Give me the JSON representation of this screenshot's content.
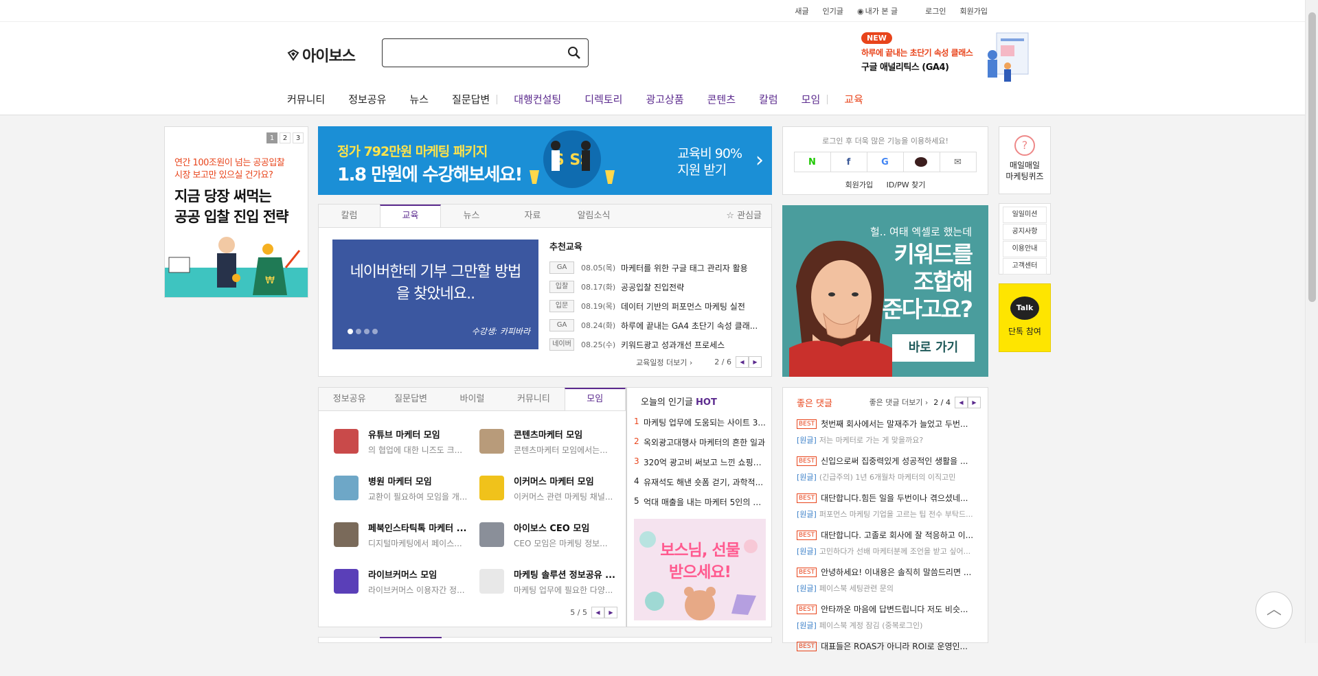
{
  "topbar": {
    "new_posts": "새글",
    "popular": "인기글",
    "my_viewed": "내가 본 글",
    "login": "로그인",
    "signup": "회원가입"
  },
  "logo": "아이보스",
  "search": {
    "placeholder": ""
  },
  "promo": {
    "badge": "NEW",
    "line1": "하루에 끝내는 초단기 속성 클래스",
    "line2": "구글 애널리틱스 (GA4)"
  },
  "nav": {
    "community": "커뮤니티",
    "info": "정보공유",
    "news": "뉴스",
    "qa": "질문답변",
    "agency": "대행컨설팅",
    "directory": "디렉토리",
    "ads": "광고상품",
    "contents": "콘텐츠",
    "column": "칼럼",
    "meeting": "모임",
    "education": "교육"
  },
  "left_ad": {
    "pages": [
      "1",
      "2",
      "3"
    ],
    "line1": "연간 100조원이 넘는 공공입찰",
    "line2": "시장 보고만 있으실 건가요?",
    "line3": "지금 당장 써먹는",
    "line4": "공공 입찰 진입 전략"
  },
  "banner": {
    "line1": "정가 792만원 마케팅 패키지",
    "line2": "1.8 만원에 수강해보세요!",
    "line3": "교육비 90%",
    "line4": "지원 받기"
  },
  "edu": {
    "tabs": [
      "칼럼",
      "교육",
      "뉴스",
      "자료",
      "알림소식"
    ],
    "fav": "☆ 관심글",
    "slide_text": "네이버한테 기부 그만할 방법을 찾았네요..",
    "slide_credit": "수강생: 카피바라",
    "rec_title": "추천교육",
    "items": [
      {
        "badge": "GA",
        "date": "08.05(목)",
        "title": "마케터를 위한 구글 태그 관리자 활용"
      },
      {
        "badge": "입찰",
        "date": "08.17(화)",
        "title": "공공입찰 진입전략"
      },
      {
        "badge": "입문",
        "date": "08.19(목)",
        "title": "데이터 기반의 퍼포먼스 마케팅 실전"
      },
      {
        "badge": "GA",
        "date": "08.24(화)",
        "title": "하루에 끝내는 GA4 초단기 속성 클래..."
      },
      {
        "badge": "네이버",
        "date": "08.25(수)",
        "title": "키워드광고 성과개선 프로세스"
      }
    ],
    "more": "교육일정 더보기 ›",
    "page": "2 / 6"
  },
  "login_box": {
    "message": "로그인 후 더욱 많은 기능을 이용하세요!",
    "signup": "회원가입",
    "find": "ID/PW 찾기"
  },
  "right_ad": {
    "line1": "헐.. 여태 엑셀로 했는데",
    "line2": "키워드를",
    "line3": "조합해",
    "line4": "준다고요?",
    "button": "바로 가기"
  },
  "side": {
    "quiz_line1": "매일매일",
    "quiz_line2": "마케팅퀴즈",
    "menu": [
      "일일미션",
      "공지사항",
      "이용안내",
      "고객센터"
    ],
    "talk_bubble": "Talk",
    "talk_label": "단톡 참여"
  },
  "meet": {
    "tabs": [
      "정보공유",
      "질문답변",
      "바이럴",
      "커뮤니티",
      "모임"
    ],
    "items": [
      {
        "name": "유튜브 마케터 모임",
        "desc": "의 협업에 대한 니즈도 크...",
        "color": "#c94a4a"
      },
      {
        "name": "콘텐츠마케터 모임",
        "desc": "콘텐츠마케터 모임에서는...",
        "color": "#b89b7a"
      },
      {
        "name": "병원 마케터 모임",
        "desc": "교환이 필요하여 모임을 개...",
        "color": "#6ea7c7"
      },
      {
        "name": "이커머스 마케터 모임",
        "desc": "이커머스 관련 마케팅 채널...",
        "color": "#f0c21b"
      },
      {
        "name": "페북인스타틱톡 마케터 ...",
        "desc": "디지털마케팅에서 페이스...",
        "color": "#7a6a5a"
      },
      {
        "name": "아이보스 CEO 모임",
        "desc": "CEO 모임은 마케팅 정보...",
        "color": "#8a8f99"
      },
      {
        "name": "라이브커머스 모임",
        "desc": "라이브커머스 이용자간 정...",
        "color": "#5a3fb8"
      },
      {
        "name": "마케팅 솔루션 정보공유 ...",
        "desc": "마케팅 업무에 필요한 다양...",
        "color": "#e8e8e8"
      }
    ],
    "page": "5 / 5"
  },
  "popular": {
    "title": "오늘의 인기글",
    "hot": "HOT",
    "items": [
      {
        "n": "1",
        "t": "마케팅 업무에 도움되는 사이트 3..."
      },
      {
        "n": "2",
        "t": "옥외광고대행사 마케터의 흔한 일과"
      },
      {
        "n": "3",
        "t": "320억 광고비 써보고 느낀 쇼핑몰..."
      },
      {
        "n": "4",
        "t": "유재석도 해낸 숏폼 걷기, 과학적..."
      },
      {
        "n": "5",
        "t": "억대 매출을 내는 마케터 5인의 이..."
      }
    ],
    "gift_line1": "보스님, 선물",
    "gift_line2": "받으세요!"
  },
  "comments": {
    "title": "좋은 댓글",
    "more": "좋은 댓글 더보기 ›",
    "page": "2 / 4",
    "best": "BEST",
    "origin": "[원글]",
    "items": [
      {
        "t": "첫번째 회사에서는 말재주가 늘었고 두번...",
        "o": "저는 마케터로 가는 게 맞을까요?"
      },
      {
        "t": "신입으로써 집중력있게 성공적인 생활을 ...",
        "o": "(긴급주의) 1년 6개월차 마케터의 이직고민"
      },
      {
        "t": "대단합니다.힘든 일을 두번이나 겪으셨네...",
        "o": "퍼포먼스 마케팅 기업을 고르는 팁 전수 부탁드..."
      },
      {
        "t": "대단합니다. 고졸로 회사에 잘 적응하고 이...",
        "o": "고민하다가 선배 마케터분께 조언을 받고 싶어..."
      },
      {
        "t": "안녕하세요! 이내용은 솔직히 말씀드리면 ...",
        "o": "페이스북 세팅관련 문의"
      },
      {
        "t": "안타까운 마음에 답변드립니다 저도 비슷...",
        "o": "페이스북 계정 잠김 (중복로그인)"
      },
      {
        "t": "대표들은 ROAS가 아니라 ROI로 운영인...",
        "o": ""
      }
    ]
  },
  "colors": {
    "purple": "#5b2a8e",
    "orange": "#e8441b",
    "banner_blue": "#1b8fd6",
    "teal": "#4a9d9d",
    "kakao": "#fee500"
  }
}
